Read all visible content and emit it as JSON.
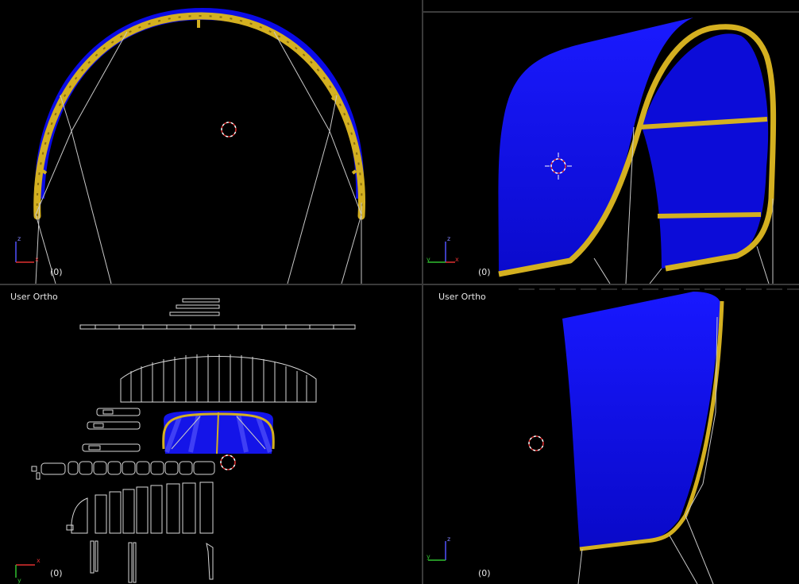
{
  "viewports": {
    "top_left": {
      "label": "",
      "frame": "(0)",
      "axes": [
        "z",
        "x"
      ]
    },
    "top_right": {
      "label": "",
      "frame": "(0)",
      "axes": [
        "z",
        "y",
        "x"
      ]
    },
    "bottom_left": {
      "label": "User Ortho",
      "frame": "(0)",
      "axes": [
        "x",
        "y"
      ]
    },
    "bottom_right": {
      "label": "User Ortho",
      "frame": "(0)",
      "axes": [
        "z",
        "y"
      ]
    }
  },
  "colors": {
    "canopy": "#0b0be6",
    "struts": "#d4b020",
    "lines": "#c8c8c8",
    "cursor_red": "#e03030",
    "axis_x": "#e03030",
    "axis_y": "#30c030",
    "axis_z": "#5050ff"
  },
  "icons": [
    "3d-cursor-icon",
    "axis-gizmo-icon"
  ]
}
